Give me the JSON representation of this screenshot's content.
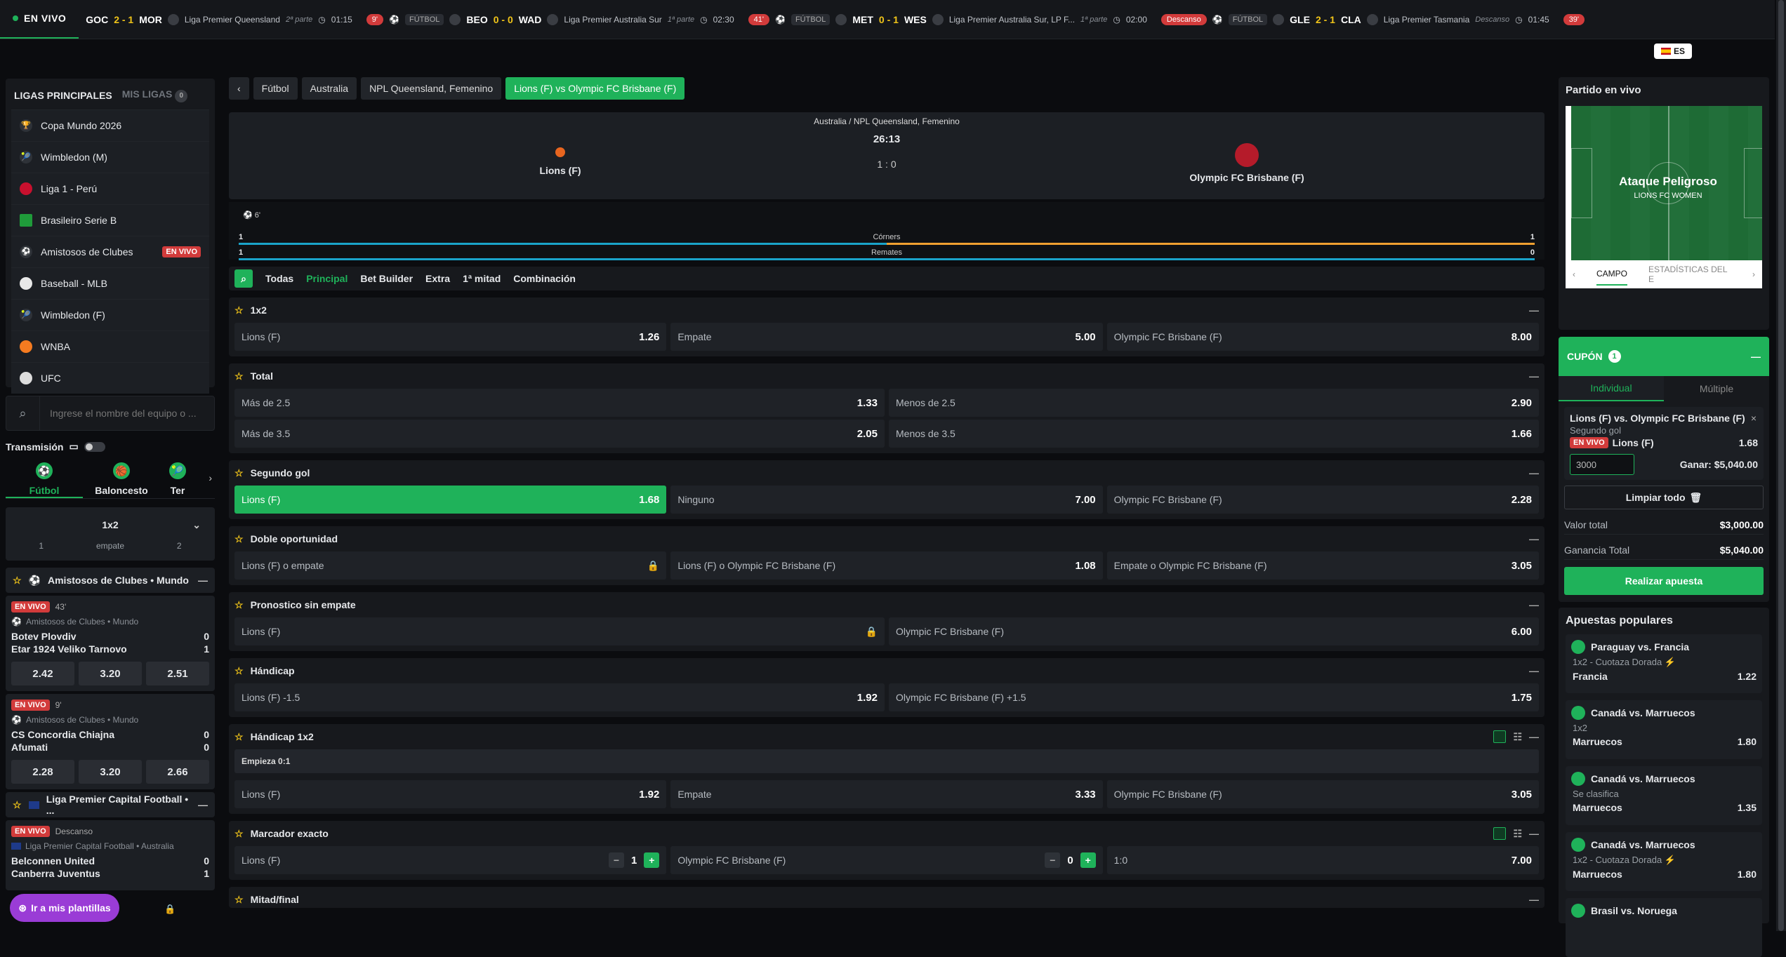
{
  "topbar": {
    "live_label": "EN VIVO",
    "items": [
      {
        "home": "GOC",
        "score": "2 - 1",
        "away": "MOR",
        "league": "Liga Premier Queensland",
        "period": "2ª parte",
        "time": "01:15"
      },
      {
        "pill": "9'",
        "sport": "FÚTBOL",
        "home": "BEO",
        "score": "0 - 0",
        "away": "WAD",
        "league": "Liga Premier Australia Sur",
        "period": "1ª parte",
        "time": "02:30"
      },
      {
        "pill": "41'",
        "sport": "FÚTBOL",
        "home": "MET",
        "score": "0 - 1",
        "away": "WES",
        "league": "Liga Premier Australia Sur, LP F...",
        "period": "1ª parte",
        "time": "02:00"
      },
      {
        "pill": "Descanso",
        "sport": "FÚTBOL",
        "home": "GLE",
        "score": "2 - 1",
        "away": "CLA",
        "league": "Liga Premier Tasmania",
        "period": "Descanso",
        "time": "01:45"
      },
      {
        "pill": "39'"
      }
    ],
    "lang": "ES"
  },
  "left": {
    "leagues_title": "LIGAS PRINCIPALES",
    "my_leagues": "MIS LIGAS",
    "my_leagues_count": "0",
    "leagues": [
      {
        "name": "Copa Mundo 2026"
      },
      {
        "name": "Wimbledon (M)"
      },
      {
        "name": "Liga 1 - Perú"
      },
      {
        "name": "Brasileiro Serie B"
      },
      {
        "name": "Amistosos de Clubes",
        "badge": "EN VIVO"
      },
      {
        "name": "Baseball - MLB"
      },
      {
        "name": "Wimbledon (F)"
      },
      {
        "name": "WNBA"
      },
      {
        "name": "UFC"
      }
    ],
    "search_placeholder": "Ingrese el nombre del equipo o ...",
    "transmission": "Transmisión",
    "sports": [
      "Fútbol",
      "Baloncesto",
      "Ter"
    ],
    "market": {
      "name": "1x2",
      "cols": [
        "1",
        "empate",
        "2"
      ]
    },
    "group1": "Amistosos de Clubes • Mundo",
    "matches": [
      {
        "live": "EN VIVO",
        "minute": "43'",
        "comp": "Amistosos de Clubes • Mundo",
        "home": "Botev Plovdiv",
        "home_score": "0",
        "away": "Etar 1924 Veliko Tarnovo",
        "away_score": "1",
        "odds": [
          "2.42",
          "3.20",
          "2.51"
        ]
      },
      {
        "live": "EN VIVO",
        "minute": "9'",
        "comp": "Amistosos de Clubes • Mundo",
        "home": "CS Concordia Chiajna",
        "home_score": "0",
        "away": "Afumati",
        "away_score": "0",
        "odds": [
          "2.28",
          "3.20",
          "2.66"
        ]
      }
    ],
    "group2": "Liga Premier Capital Football • ...",
    "match3": {
      "live": "EN VIVO",
      "minute": "Descanso",
      "comp": "Liga Premier Capital Football • Australia",
      "home": "Belconnen United",
      "home_score": "0",
      "away": "Canberra Juventus",
      "away_score": "1"
    },
    "fab": "Ir a mis plantillas"
  },
  "center": {
    "breadcrumb": [
      "Fútbol",
      "Australia",
      "NPL Queensland, Femenino",
      "Lions (F)  vs  Olympic FC Brisbane (F)"
    ],
    "scoreboard": {
      "competition": "Australia / NPL Queensland, Femenino",
      "clock": "26:13",
      "score": "1 : 0",
      "home": "Lions (F)",
      "away": "Olympic FC Brisbane (F)"
    },
    "event_minute": "6'",
    "stats": [
      {
        "label": "Córners",
        "home": "1",
        "away": "1"
      },
      {
        "label": "Remates",
        "home": "1",
        "away": "0"
      }
    ],
    "filters": [
      "Todas",
      "Principal",
      "Bet Builder",
      "Extra",
      "1ª mitad",
      "Combinación"
    ],
    "markets": {
      "m1x2": {
        "title": "1x2",
        "odds": [
          {
            "l": "Lions (F)",
            "v": "1.26"
          },
          {
            "l": "Empate",
            "v": "5.00"
          },
          {
            "l": "Olympic FC Brisbane (F)",
            "v": "8.00"
          }
        ]
      },
      "total": {
        "title": "Total",
        "rows": [
          [
            {
              "l": "Más de 2.5",
              "v": "1.33"
            },
            {
              "l": "Menos de 2.5",
              "v": "2.90"
            }
          ],
          [
            {
              "l": "Más de 3.5",
              "v": "2.05"
            },
            {
              "l": "Menos de 3.5",
              "v": "1.66"
            }
          ]
        ]
      },
      "second": {
        "title": "Segundo gol",
        "odds": [
          {
            "l": "Lions (F)",
            "v": "1.68"
          },
          {
            "l": "Ninguno",
            "v": "7.00"
          },
          {
            "l": "Olympic FC Brisbane (F)",
            "v": "2.28"
          }
        ]
      },
      "double": {
        "title": "Doble oportunidad",
        "odds": [
          {
            "l": "Lions (F) o empate",
            "v": ""
          },
          {
            "l": "Lions (F) o Olympic FC Brisbane (F)",
            "v": "1.08"
          },
          {
            "l": "Empate o Olympic FC Brisbane (F)",
            "v": "3.05"
          }
        ]
      },
      "dnb": {
        "title": "Pronostico sin empate",
        "odds": [
          {
            "l": "Lions (F)",
            "v": ""
          },
          {
            "l": "Olympic FC Brisbane (F)",
            "v": "6.00"
          }
        ]
      },
      "hcp": {
        "title": "Hándicap",
        "odds": [
          {
            "l": "Lions (F) -1.5",
            "v": "1.92"
          },
          {
            "l": "Olympic FC Brisbane (F) +1.5",
            "v": "1.75"
          }
        ]
      },
      "hcp1x2": {
        "title": "Hándicap 1x2",
        "sub": "Empieza 0:1",
        "odds": [
          {
            "l": "Lions (F)",
            "v": "1.92"
          },
          {
            "l": "Empate",
            "v": "3.33"
          },
          {
            "l": "Olympic FC Brisbane (F)",
            "v": "3.05"
          }
        ]
      },
      "exact": {
        "title": "Marcador exacto",
        "home": "Lions (F)",
        "home_val": "1",
        "away": "Olympic FC Brisbane (F)",
        "away_val": "0",
        "result": "1:0",
        "odd": "7.00"
      },
      "htft": {
        "title": "Mitad/final"
      }
    }
  },
  "right": {
    "live_title": "Partido en vivo",
    "attack": "Ataque Peligroso",
    "attack_team": "LIONS FC WOMEN",
    "pitch_tabs": [
      "CAMPO",
      "ESTADÍSTICAS DEL E"
    ],
    "coupon": {
      "title": "CUPÓN",
      "count": "1",
      "tabs": [
        "Individual",
        "Múltiple"
      ],
      "bet_title": "Lions (F) vs. Olympic FC Brisbane (F)",
      "bet_market": "Segundo gol",
      "live": "EN VIVO",
      "pick": "Lions (F)",
      "odd": "1.68",
      "stake": "3000",
      "win": "Ganar: $5,040.00",
      "clear": "Limpiar todo",
      "total_label": "Valor total",
      "total": "$3,000.00",
      "gain_label": "Ganancia Total",
      "gain": "$5,040.00",
      "place": "Realizar apuesta"
    },
    "popular_title": "Apuestas populares",
    "popular": [
      {
        "match": "Paraguay vs. Francia",
        "market": "1x2 - Cuotaza Dorada",
        "pick": "Francia",
        "odd": "1.22"
      },
      {
        "match": "Canadá vs. Marruecos",
        "market": "1x2",
        "pick": "Marruecos",
        "odd": "1.80"
      },
      {
        "match": "Canadá vs. Marruecos",
        "market": "Se clasifica",
        "pick": "Marruecos",
        "odd": "1.35"
      },
      {
        "match": "Canadá vs. Marruecos",
        "market": "1x2 - Cuotaza Dorada",
        "pick": "Marruecos",
        "odd": "1.80"
      },
      {
        "match": "Brasil vs. Noruega"
      }
    ]
  }
}
